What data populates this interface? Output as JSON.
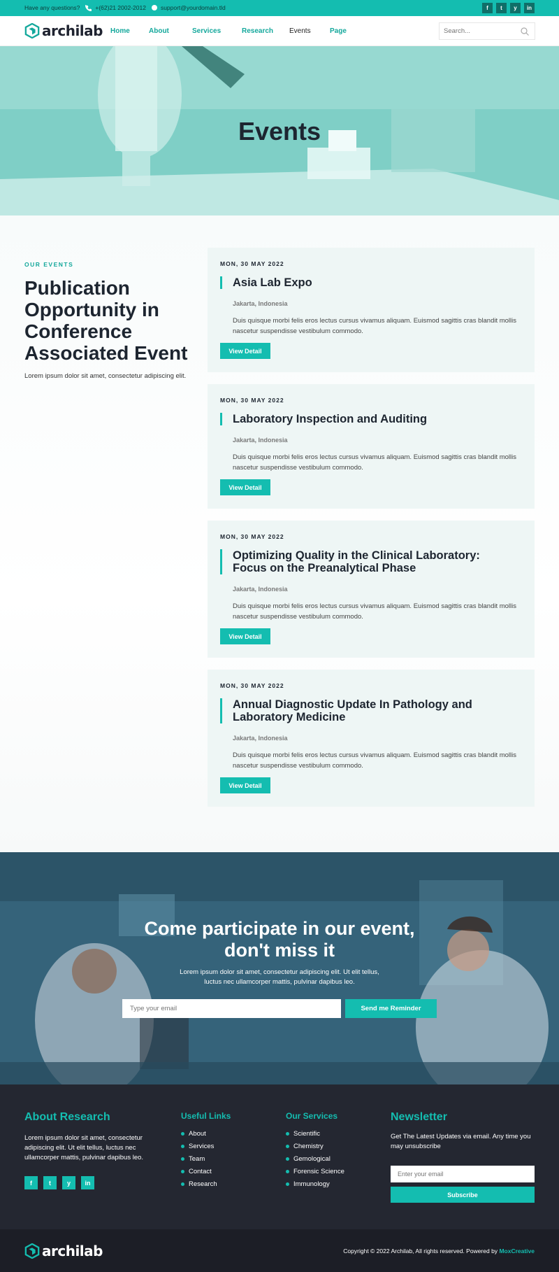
{
  "topbar": {
    "question": "Have any questions?",
    "phone": "+(62)21 2002-2012",
    "email": "support@yourdomain.tld",
    "social": [
      "f",
      "t",
      "y",
      "in"
    ]
  },
  "header": {
    "logo_text": "archilab",
    "nav": [
      {
        "label": "Home"
      },
      {
        "label": "About"
      },
      {
        "label": "Services"
      },
      {
        "label": "Research"
      },
      {
        "label": "Events"
      },
      {
        "label": "Page"
      }
    ],
    "search_placeholder": "Search..."
  },
  "hero": {
    "title": "Events"
  },
  "events_intro": {
    "eyebrow": "OUR EVENTS",
    "title": "Publication Opportunity in Conference Associated Event",
    "desc": "Lorem ipsum dolor sit amet, consectetur adipiscing elit."
  },
  "events": [
    {
      "date": "MON, 30 MAY 2022",
      "title": "Asia Lab Expo",
      "location": "Jakarta, Indonesia",
      "desc": "Duis quisque morbi felis eros lectus cursus vivamus aliquam. Euismod sagittis cras blandit mollis nascetur suspendisse vestibulum commodo.",
      "button": "View Detail"
    },
    {
      "date": "MON, 30 MAY 2022",
      "title": "Laboratory Inspection and Auditing",
      "location": "Jakarta, Indonesia",
      "desc": "Duis quisque morbi felis eros lectus cursus vivamus aliquam. Euismod sagittis cras blandit mollis nascetur suspendisse vestibulum commodo.",
      "button": "View Detail"
    },
    {
      "date": "MON, 30 MAY 2022",
      "title": "Optimizing Quality in the Clinical Laboratory: Focus on the Preanalytical Phase",
      "location": "Jakarta, Indonesia",
      "desc": "Duis quisque morbi felis eros lectus cursus vivamus aliquam. Euismod sagittis cras blandit mollis nascetur suspendisse vestibulum commodo.",
      "button": "View Detail"
    },
    {
      "date": "MON, 30 MAY 2022",
      "title": "Annual Diagnostic Update In Pathology and Laboratory Medicine",
      "location": "Jakarta, Indonesia",
      "desc": "Duis quisque morbi felis eros lectus cursus vivamus aliquam. Euismod sagittis cras blandit mollis nascetur suspendisse vestibulum commodo.",
      "button": "View Detail"
    }
  ],
  "cta": {
    "title_line1": "Come participate in our event,",
    "title_line2": "don't miss it",
    "desc": "Lorem ipsum dolor sit amet, consectetur adipiscing elit. Ut elit tellus, luctus nec ullamcorper mattis, pulvinar dapibus leo.",
    "email_placeholder": "Type your email",
    "button": "Send me Reminder"
  },
  "footer": {
    "about_title": "About Research",
    "about_text": "Lorem ipsum dolor sit amet, consectetur adipiscing elit. Ut elit tellus, luctus nec ullamcorper mattis, pulvinar dapibus leo.",
    "social": [
      "f",
      "t",
      "y",
      "in"
    ],
    "links_title": "Useful Links",
    "links": [
      "About",
      "Services",
      "Team",
      "Contact",
      "Research"
    ],
    "services_title": "Our Services",
    "services": [
      "Scientific",
      "Chemistry",
      "Gemological",
      "Forensic Science",
      "Immunology"
    ],
    "newsletter_title": "Newsletter",
    "newsletter_text": "Get The Latest Updates via email. Any time you may unsubscribe",
    "newsletter_placeholder": "Enter your email",
    "newsletter_button": "Subscribe"
  },
  "bottombar": {
    "logo_text": "archilab",
    "copyright": "Copyright © 2022 Archilab, All rights reserved. Powered by",
    "brand": "MoxCreative"
  },
  "colors": {
    "accent": "#14bdb0",
    "dark": "#1d2530",
    "footer_bg": "#242731"
  }
}
